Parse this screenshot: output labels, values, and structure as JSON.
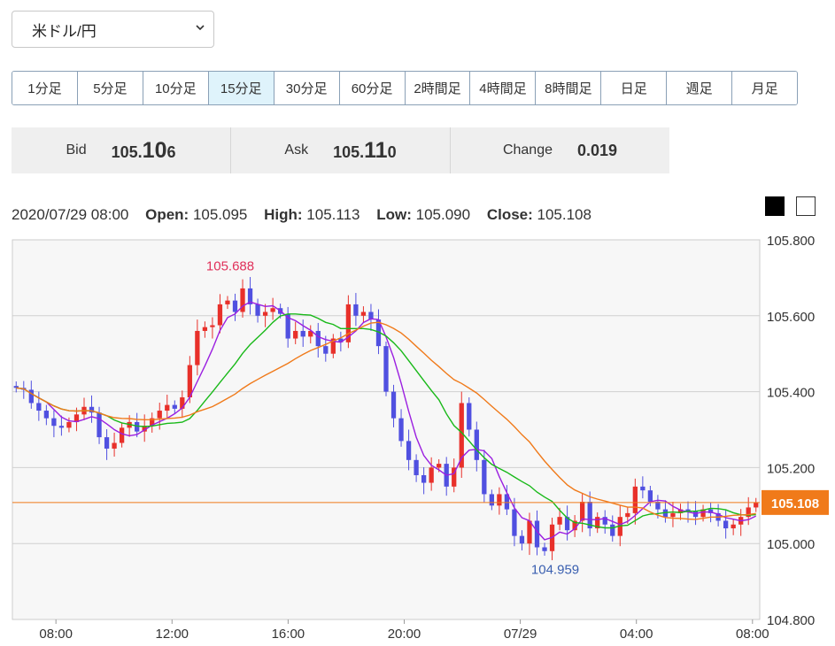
{
  "pair_select": {
    "value": "米ドル/円",
    "icon": "chevron-down-icon"
  },
  "timeframes": [
    {
      "label": "1分足",
      "active": false
    },
    {
      "label": "5分足",
      "active": false
    },
    {
      "label": "10分足",
      "active": false
    },
    {
      "label": "15分足",
      "active": true
    },
    {
      "label": "30分足",
      "active": false
    },
    {
      "label": "60分足",
      "active": false
    },
    {
      "label": "2時間足",
      "active": false
    },
    {
      "label": "4時間足",
      "active": false
    },
    {
      "label": "8時間足",
      "active": false
    },
    {
      "label": "日足",
      "active": false
    },
    {
      "label": "週足",
      "active": false
    },
    {
      "label": "月足",
      "active": false
    }
  ],
  "quote": {
    "bid_label": "Bid",
    "bid_main": "105.",
    "bid_big": "10",
    "bid_tail": "6",
    "ask_label": "Ask",
    "ask_main": "105.",
    "ask_big": "11",
    "ask_tail": "0",
    "change_label": "Change",
    "change_value": "0.019"
  },
  "ohlc": {
    "datetime": "2020/07/29 08:00",
    "open_label": "Open:",
    "open": "105.095",
    "high_label": "High:",
    "high": "105.113",
    "low_label": "Low:",
    "low": "105.090",
    "close_label": "Close:",
    "close": "105.108"
  },
  "theme": {
    "dark": "black",
    "light": "white"
  },
  "colors": {
    "up": "#e8302a",
    "down": "#5050e0",
    "ma_short": "#9b1fe0",
    "ma_mid": "#19b919",
    "ma_long": "#f07a1a",
    "price_line": "#f07a1a",
    "high_label": "#e0305a",
    "low_label": "#3a5fb0"
  },
  "chart_data": {
    "type": "candlestick",
    "interval": "15min",
    "y_ticks": [
      "105.800",
      "105.600",
      "105.400",
      "105.200",
      "105.000",
      "104.800"
    ],
    "y_tick_values": [
      105.8,
      105.6,
      105.4,
      105.2,
      105.0,
      104.8
    ],
    "x_ticks": [
      "08:00",
      "12:00",
      "16:00",
      "20:00",
      "07/29",
      "04:00",
      "08:00"
    ],
    "ylim": [
      104.8,
      105.8
    ],
    "current_price": "105.108",
    "current_value": 105.108,
    "max_label": "105.688",
    "min_label": "104.959",
    "max_index": 30,
    "min_index": 70,
    "closes": [
      105.41,
      105.405,
      105.37,
      105.35,
      105.33,
      105.31,
      105.305,
      105.32,
      105.34,
      105.36,
      105.345,
      105.28,
      105.25,
      105.265,
      105.305,
      105.32,
      105.295,
      105.31,
      105.33,
      105.35,
      105.365,
      105.355,
      105.385,
      105.47,
      105.56,
      105.57,
      105.575,
      105.63,
      105.64,
      105.61,
      105.672,
      105.63,
      105.6,
      105.61,
      105.62,
      105.605,
      105.54,
      105.56,
      105.545,
      105.56,
      105.52,
      105.5,
      105.54,
      105.53,
      105.63,
      105.6,
      105.61,
      105.59,
      105.52,
      105.4,
      105.33,
      105.27,
      105.22,
      105.18,
      105.16,
      105.2,
      105.21,
      105.15,
      105.2,
      105.37,
      105.3,
      105.22,
      105.13,
      105.1,
      105.13,
      105.09,
      105.02,
      105.0,
      105.06,
      104.99,
      104.98,
      105.05,
      105.07,
      105.035,
      105.06,
      105.11,
      105.04,
      105.07,
      105.05,
      105.02,
      105.07,
      105.08,
      105.15,
      105.14,
      105.11,
      105.09,
      105.07,
      105.08,
      105.09,
      105.085,
      105.07,
      105.09,
      105.08,
      105.06,
      105.04,
      105.05,
      105.07,
      105.095,
      105.108
    ],
    "ma_periods": [
      5,
      13,
      25
    ]
  }
}
